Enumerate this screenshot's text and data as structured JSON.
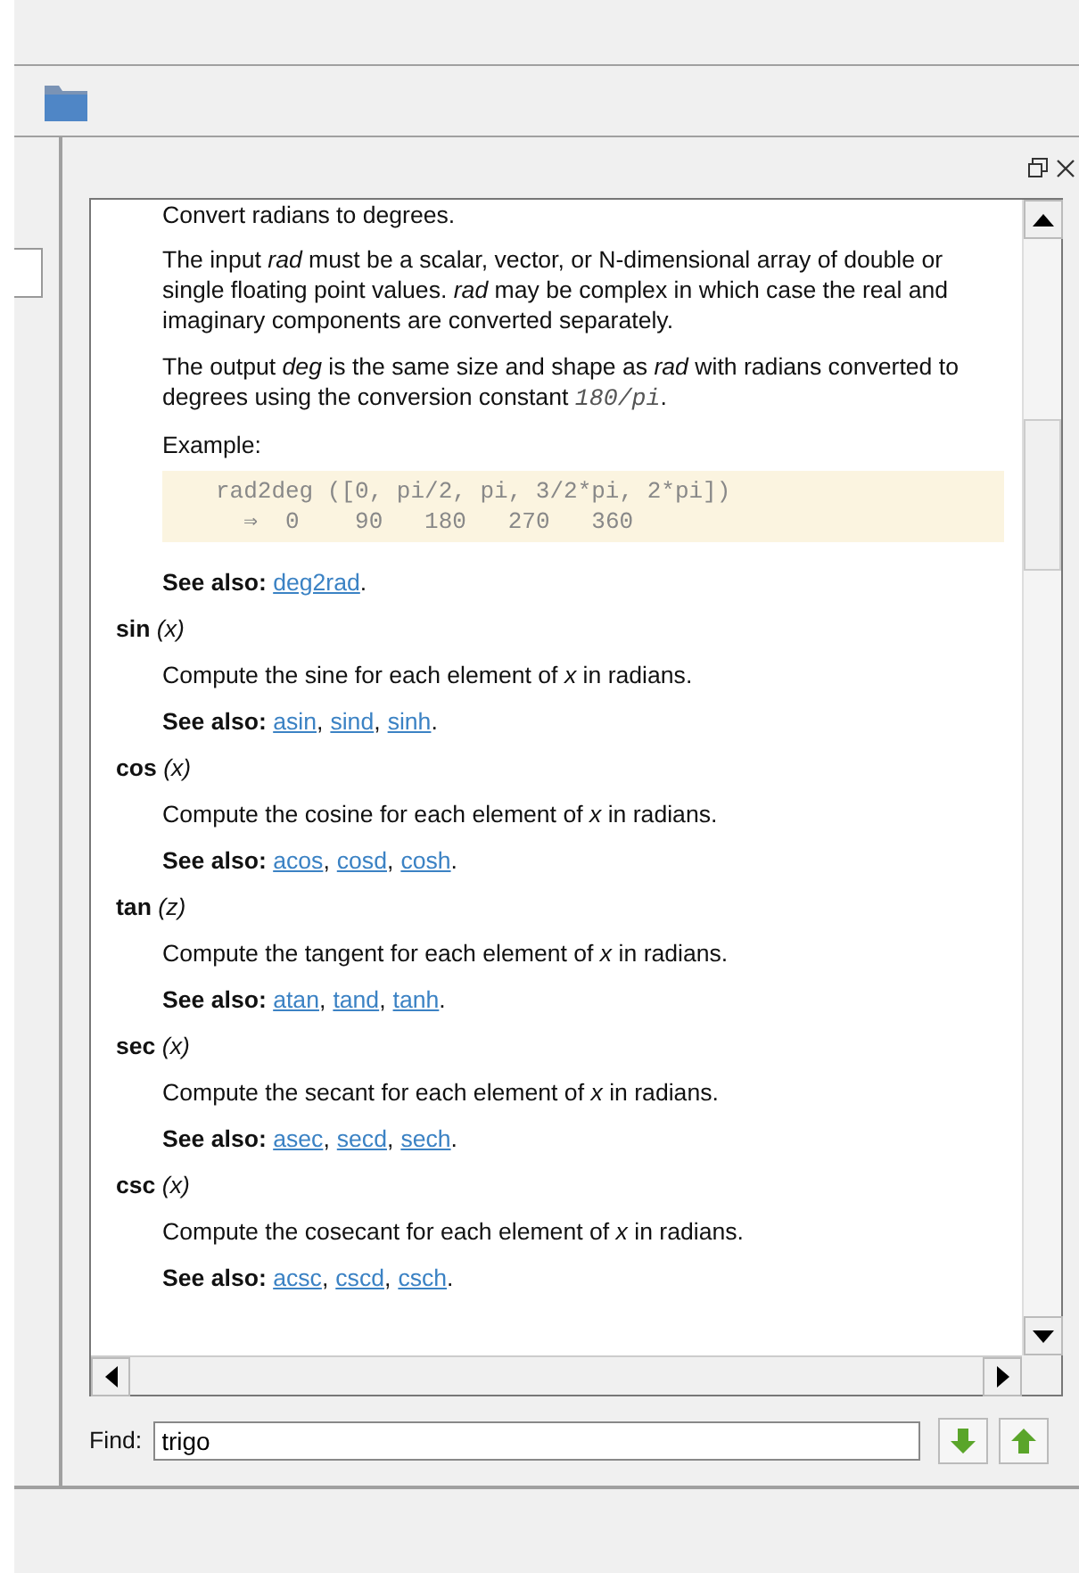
{
  "doc": {
    "intro": "Convert radians to degrees.",
    "paragraphs": [
      {
        "text": "The input *rad* must be a scalar, vector, or N-dimensional array of double or single floating point values. *rad* may be complex in which case the real and imaginary components are converted separately."
      },
      {
        "text": "The output *deg* is the same size and shape as *rad* with radians converted to degrees using the conversion constant ",
        "code": "180/pi",
        "after": "."
      }
    ],
    "example_label": "Example:",
    "code": [
      "rad2deg ([0, pi/2, pi, 3/2*pi, 2*pi])",
      "  ⇒  0    90   180   270   360"
    ],
    "see_also_label": "See also:",
    "see_also": [
      "deg2rad"
    ]
  },
  "separators": {
    "between": ",",
    "end": "."
  },
  "functions": [
    {
      "name": "sin",
      "args": "(x)",
      "description": "Compute the sine for each element of *x* in radians.",
      "see_also_label": "See also:",
      "see_also": [
        "asin",
        "sind",
        "sinh"
      ]
    },
    {
      "name": "cos",
      "args": "(x)",
      "description": "Compute the cosine for each element of *x* in radians.",
      "see_also_label": "See also:",
      "see_also": [
        "acos",
        "cosd",
        "cosh"
      ]
    },
    {
      "name": "tan",
      "args": "(z)",
      "description": "Compute the tangent for each element of *x* in radians.",
      "see_also_label": "See also:",
      "see_also": [
        "atan",
        "tand",
        "tanh"
      ]
    },
    {
      "name": "sec",
      "args": "(x)",
      "description": "Compute the secant for each element of *x* in radians.",
      "see_also_label": "See also:",
      "see_also": [
        "asec",
        "secd",
        "sech"
      ]
    },
    {
      "name": "csc",
      "args": "(x)",
      "description": "Compute the cosecant for each element of *x* in radians.",
      "see_also_label": "See also:",
      "see_also": [
        "acsc",
        "cscd",
        "csch"
      ]
    }
  ],
  "find": {
    "label": "Find:",
    "value": "trigo"
  }
}
